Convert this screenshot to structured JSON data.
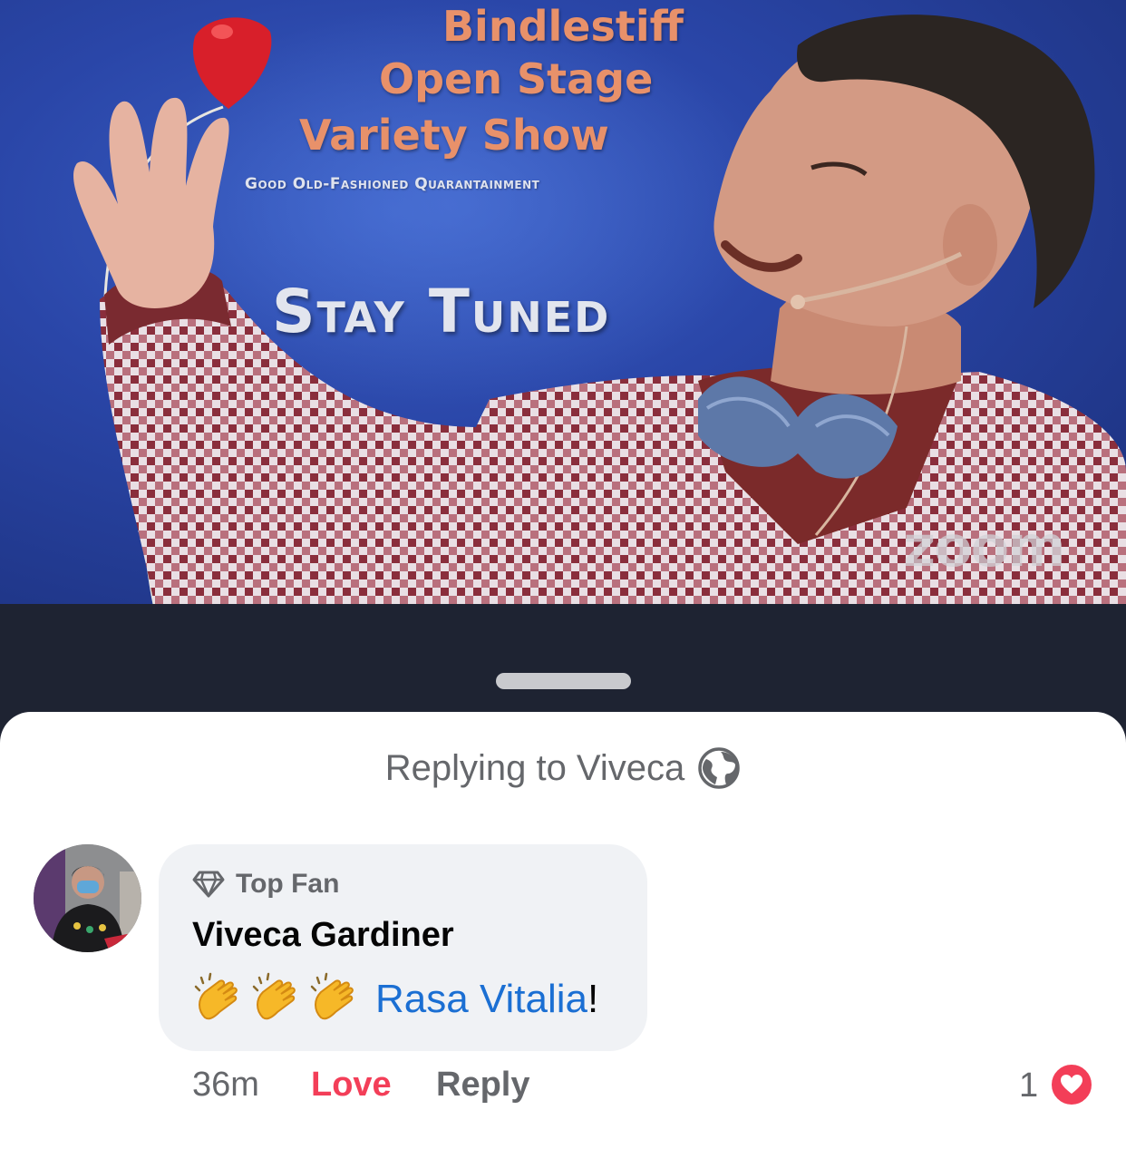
{
  "video": {
    "title_lines": [
      "Bindlestiff",
      "Open Stage",
      "Variety Show"
    ],
    "tagline": "Good Old-Fashioned Quarantainment",
    "status": "Stay Tuned",
    "watermark": "zoom"
  },
  "sheet": {
    "replying_to": "Replying to Viveca",
    "privacy_icon": "globe-icon"
  },
  "comment": {
    "badge": "Top Fan",
    "badge_icon": "diamond-icon",
    "author": "Viveca Gardiner",
    "emoji": "👏👏👏",
    "mention": "Rasa Vitalia",
    "trailing": "!",
    "time": "36m",
    "love_label": "Love",
    "reply_label": "Reply",
    "reaction_count": "1",
    "reaction_icon": "heart-icon"
  },
  "colors": {
    "love": "#f33e58",
    "mention": "#1b6fd3",
    "secondary_text": "#65676b",
    "bubble": "#f0f2f5"
  }
}
